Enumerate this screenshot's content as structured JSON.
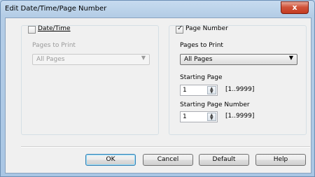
{
  "window": {
    "title": "Edit Date/Time/Page Number",
    "close_label": "x"
  },
  "date_time": {
    "checkbox_label": "Date/Time",
    "checked": false,
    "pages_label": "Pages to Print",
    "pages_value": "All Pages"
  },
  "page_number": {
    "checkbox_label": "Page Number",
    "checked": true,
    "pages_label": "Pages to Print",
    "pages_value": "All Pages",
    "starting_page_label": "Starting Page",
    "starting_page_value": "1",
    "starting_page_range": "[1..9999]",
    "starting_number_label": "Starting Page Number",
    "starting_number_value": "1",
    "starting_number_range": "[1..9999]"
  },
  "buttons": {
    "ok": "OK",
    "cancel": "Cancel",
    "default": "Default",
    "help": "Help"
  },
  "icons": {
    "dropdown": "chevron-down-icon",
    "spin": "spin-arrows-icon",
    "close": "close-icon"
  }
}
